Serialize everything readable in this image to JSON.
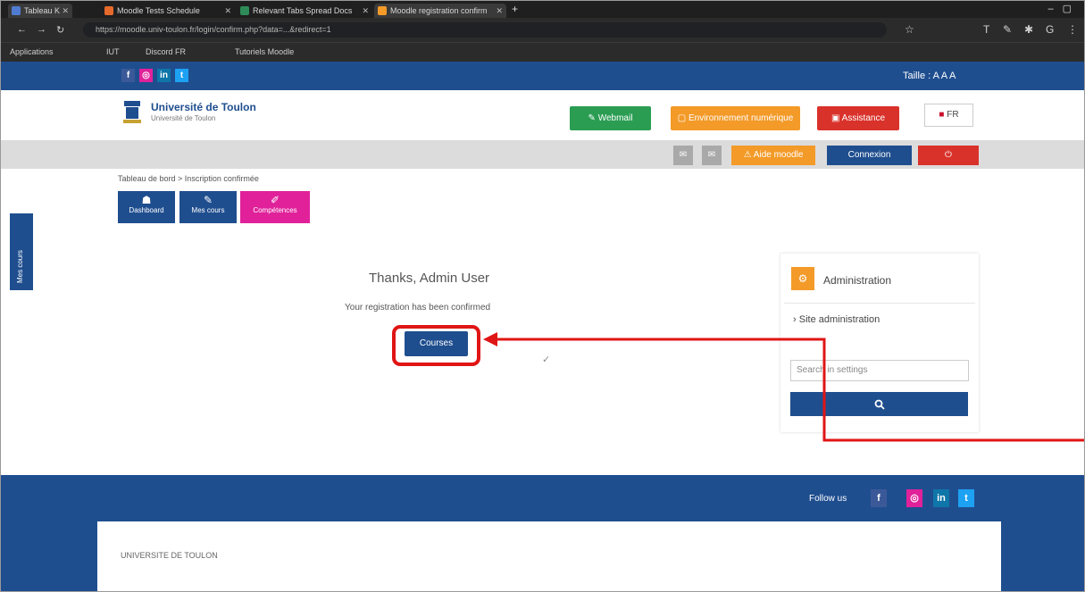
{
  "browser": {
    "tabs": [
      {
        "label": "Tableau K"
      },
      {
        "label": "Moodle Tests Schedule"
      },
      {
        "label": "Relevant Tabs Spread Docs"
      },
      {
        "label": "Moodle registration confirm"
      }
    ],
    "url": "https://moodle.univ-toulon.fr/login/confirm.php?data=...&redirect=1",
    "bookmarks": [
      "Applications",
      "IUT",
      "Discord FR",
      "Tutoriels Moodle"
    ]
  },
  "site": {
    "lang_switch": "Taille : A A A",
    "logo": {
      "name": "Université de Toulon",
      "sub": "Université de Toulon"
    },
    "header_buttons": {
      "webmail": "Webmail",
      "environment": "Environnement numérique",
      "help": "Assistance",
      "flag": "FR"
    },
    "graybar_buttons": {
      "first": "Aide moodle",
      "connect": "Connexion",
      "logout": "Déconnexion"
    },
    "breadcrumb": "Tableau de bord > Inscription confirmée",
    "nav_tiles": [
      {
        "icon": "☗",
        "label": "Dashboard"
      },
      {
        "icon": "✎",
        "label": "Mes cours"
      },
      {
        "icon": "✐",
        "label": "Compétences"
      }
    ],
    "side_tab": "Mes cours"
  },
  "main": {
    "heading": "Thanks, Admin User",
    "text": "Your registration has been confirmed",
    "button": "Courses"
  },
  "admin": {
    "title": "Administration",
    "link": "Site administration",
    "search_placeholder": "Search in settings",
    "search_icon": "search-icon"
  },
  "footer": {
    "follow": "Follow us",
    "copyright": "UNIVERSITE DE TOULON"
  },
  "colors": {
    "brand": "#1f4e8f",
    "green": "#2a9d53",
    "orange": "#f39a28",
    "red": "#d9322b",
    "pink": "#e0219a",
    "highlight": "#e01515"
  }
}
